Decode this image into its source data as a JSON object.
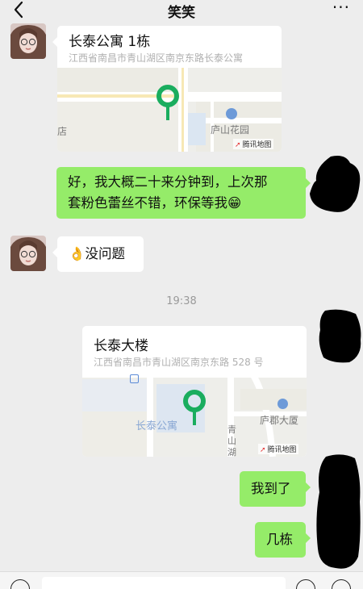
{
  "header": {
    "title": "笑笑",
    "more_label": "···"
  },
  "messages": {
    "loc1": {
      "title": "长泰公寓 1栋",
      "address": "江西省南昌市青山湖区南京东路长泰公寓"
    },
    "map1": {
      "labels": [
        "店",
        "庐山花园"
      ],
      "brand": "腾讯地图"
    },
    "msg_out_1": {
      "line1": "好，我大概二十来分钟到，上次那",
      "line2": "套粉色蕾丝不错，环保等我😁"
    },
    "msg_in_1": {
      "text": "👌没问题"
    },
    "time": "19:38",
    "loc2": {
      "title": "长泰大楼",
      "address": "江西省南昌市青山湖区南京东路 528 号"
    },
    "map2": {
      "labels": [
        "长泰公寓",
        "庐郡大厦",
        "青",
        "山",
        "湖"
      ],
      "brand": "腾讯地图"
    },
    "msg_out_2": {
      "text": "我到了"
    },
    "msg_out_3": {
      "text": "几栋"
    }
  },
  "colors": {
    "self_bubble": "#95ec69",
    "other_bubble": "#ffffff",
    "background": "#ededed",
    "pin": "#1aad5e"
  },
  "icons": [
    "back-icon",
    "more-icon",
    "location-pin-icon",
    "voice-icon",
    "emoji-icon",
    "plus-icon"
  ]
}
